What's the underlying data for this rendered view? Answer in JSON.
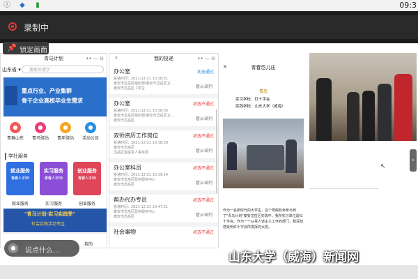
{
  "status_bar": {
    "time": "09:3"
  },
  "recording": {
    "label": "录制中"
  },
  "lock_button": {
    "label": "锁定画面"
  },
  "left_phone": {
    "title": "青马计划",
    "region": "山东省",
    "search_placeholder": "搜索关键字",
    "banner_line1": "重点行业、产业集群",
    "banner_line2": "骨干企业高校毕业生需求",
    "icons": [
      {
        "label": "青春山东",
        "color": "#f05a5a",
        "glyph": "●"
      },
      {
        "label": "青马驿站",
        "color": "#e8407a",
        "glyph": "●"
      },
      {
        "label": "青年驿站",
        "color": "#f5a623",
        "glyph": "●"
      },
      {
        "label": "活动公告",
        "color": "#2a8fe0",
        "glyph": "●"
      }
    ],
    "section_title": "学社服务",
    "cards": [
      {
        "title": "就业服务",
        "subtitle": "青春人才ID",
        "label": "就业服务",
        "color": "#2f6fe0"
      },
      {
        "title": "实习服务",
        "subtitle": "青春人才ID",
        "label": "实习服务",
        "color": "#8a4fd6"
      },
      {
        "title": "创业服务",
        "subtitle": "青春人才ID",
        "label": "创业服务",
        "color": "#e0465a"
      }
    ],
    "footer_banner_line1": "\"青马计划·实习实践季\"",
    "footer_banner_line2": "社会实践活动专区",
    "nav": [
      "首页",
      "我的"
    ]
  },
  "say_box": {
    "placeholder": "说点什么..."
  },
  "middle_phone": {
    "title": "我的投递",
    "items": [
      {
        "title": "办公室",
        "meta1": "投递时间：2021-12-21 10:38:51",
        "meta2": "泰安市岱岳区组织部/泰安市岱岳区卫...",
        "meta3": "泰安市岱岳区 1学生",
        "status": "初选通过",
        "status_color": "#2a8fe0",
        "action": "暂从调剂"
      },
      {
        "title": "办公室",
        "meta1": "投递时间：2021-12-21 10:38:56",
        "meta2": "泰安市岱岳区组织部/泰安市岱岳区卫...",
        "meta3": "泰安市岱岳区",
        "status": "初选不通过",
        "status_color": "#e23b3b",
        "action": "暂从调剂"
      },
      {
        "title": "双师资历工作岗位",
        "meta1": "投递时间：2021-12-21 10:38:59",
        "meta2": "泰安市岱岳区",
        "meta3": "岱岳区退役军人事务局",
        "status": "初选不通过",
        "status_color": "#e23b3b",
        "action": "暂从调剂"
      },
      {
        "title": "办公室科员",
        "meta1": "投递时间：2021-12-21 10:39:14",
        "meta2": "泰安市岱岳区政务服务中心",
        "meta3": "泰安市岱岳区",
        "status": "初选不通过",
        "status_color": "#e23b3b",
        "action": "暂从调剂"
      },
      {
        "title": "帮办代办专员",
        "meta1": "投递时间：2021-12-21 10:47:51",
        "meta2": "泰安市岱岳区政务服务中心",
        "meta3": "泰安市岱岳区",
        "status": "初选不通过",
        "status_color": "#e23b3b",
        "action": "暂从调剂"
      },
      {
        "title": "社会事物",
        "meta1": "",
        "meta2": "",
        "meta3": "",
        "status": "初选不通过",
        "status_color": "#e23b3b",
        "action": ""
      }
    ]
  },
  "right_phone": {
    "title": "青春岱儿庄",
    "subtitle": "青岛",
    "info": [
      "实习学校：红十字会",
      "实践学校：山东大学（威海）"
    ],
    "body": "作为一名新时代的大学生，这个寒假有幸参与到了\"青马计划\"泰安岱岳区实践中，我所实习单位是红十字会。作为一个从事人道主义工作的部门，我深刻感受到红十字会所发挥的大爱。"
  },
  "watermark": {
    "text": "山东大学（威海）新闻网"
  }
}
